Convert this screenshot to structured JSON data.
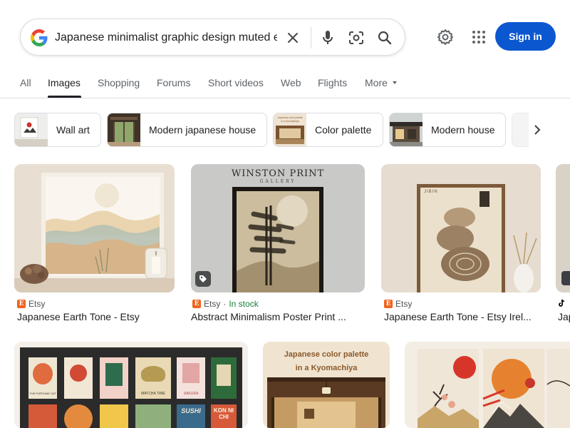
{
  "search": {
    "query": "Japanese minimalist graphic design muted e"
  },
  "header": {
    "sign_in_label": "Sign in"
  },
  "tabs": [
    {
      "label": "All",
      "active": false
    },
    {
      "label": "Images",
      "active": true
    },
    {
      "label": "Shopping",
      "active": false
    },
    {
      "label": "Forums",
      "active": false
    },
    {
      "label": "Short videos",
      "active": false
    },
    {
      "label": "Web",
      "active": false
    },
    {
      "label": "Flights",
      "active": false
    },
    {
      "label": "More",
      "active": false
    }
  ],
  "chips": [
    {
      "label": "Wall art"
    },
    {
      "label": "Modern japanese house"
    },
    {
      "label": "Color palette"
    },
    {
      "label": "Modern house"
    }
  ],
  "results": [
    {
      "source": "Etsy",
      "stock": "",
      "title": "Japanese Earth Tone - Etsy"
    },
    {
      "source": "Etsy",
      "stock": "In stock",
      "title": "Abstract Minimalism Poster Print ..."
    },
    {
      "source": "Etsy",
      "stock": "",
      "title": "Japanese Earth Tone - Etsy Irel..."
    },
    {
      "source": "",
      "stock": "",
      "title": "Jap"
    }
  ],
  "image_text": {
    "winston_print": "WINSTON PRINT",
    "gallery": "GALLERY",
    "jibin": "JIBIN",
    "palette_line1": "Japanese color palette",
    "palette_line2": "in a Kyomachiya",
    "chip_palette_line1": "Japanese color palette",
    "chip_palette_line2": "in a Kyomachiya",
    "matcha": "MATCHA TIME",
    "sakura": "SAKURA",
    "sushi": "SUSHI",
    "konnichi": "KON NI CHI",
    "fortune": "THE FORTUNE CAT"
  },
  "colors": {
    "sign_in_bg": "#0b57d0",
    "in_stock": "#188038",
    "etsy": "#f1641e",
    "active_tab": "#202124"
  },
  "icons": [
    "google-g-icon",
    "clear-icon",
    "microphone-icon",
    "camera-lens-icon",
    "search-icon",
    "gear-icon",
    "apps-grid-icon",
    "chevron-right-icon",
    "tag-icon",
    "etsy-icon",
    "tiktok-icon"
  ]
}
